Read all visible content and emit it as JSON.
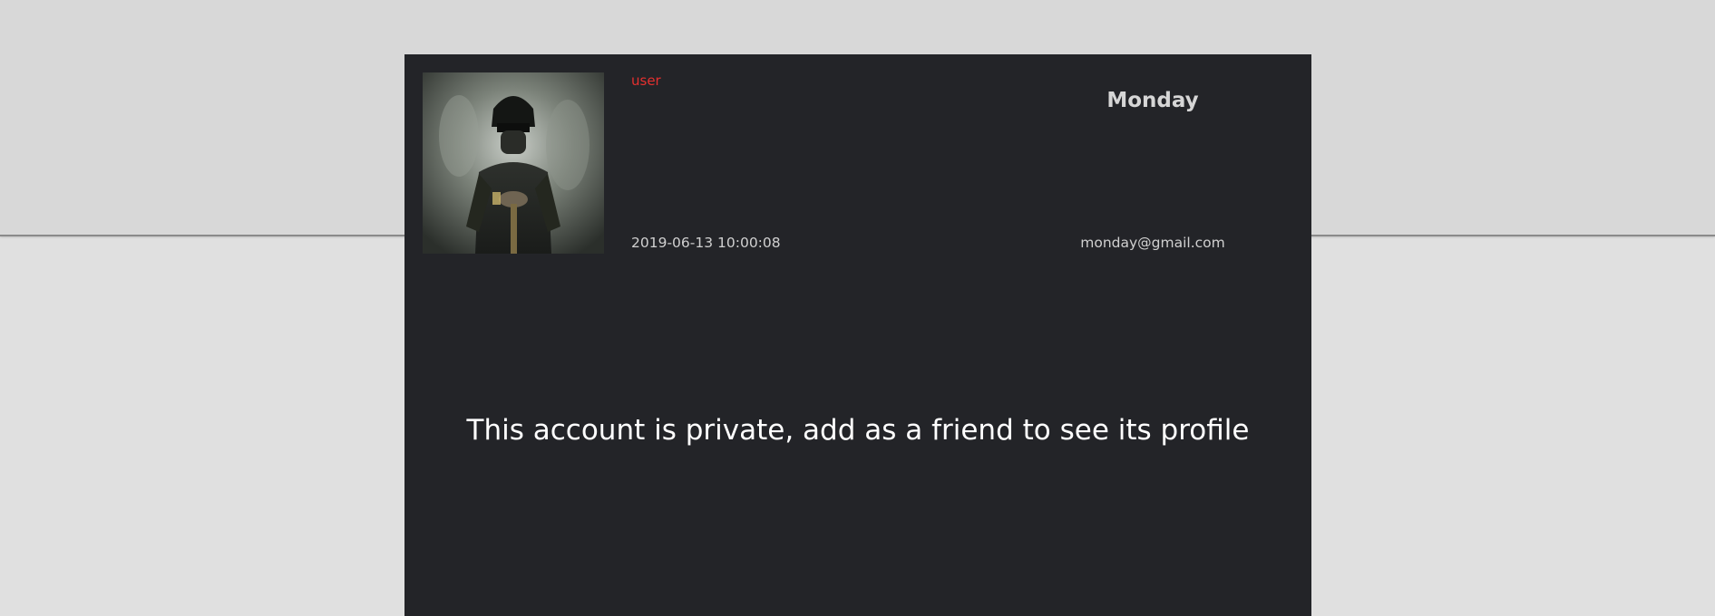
{
  "profile": {
    "role": "user",
    "username": "Monday",
    "joined": "2019-06-13 10:00:08",
    "email": "monday@gmail.com",
    "avatar_icon": "soldier-avatar",
    "private_message": "This account is private, add as a friend to see its profile"
  },
  "colors": {
    "page_background": "#e0e0e0",
    "header_band": "#d8d8d8",
    "card_background": "#232428",
    "role_color": "#e5302f",
    "text_light": "#d0d0d0",
    "message_color": "#ffffff"
  }
}
